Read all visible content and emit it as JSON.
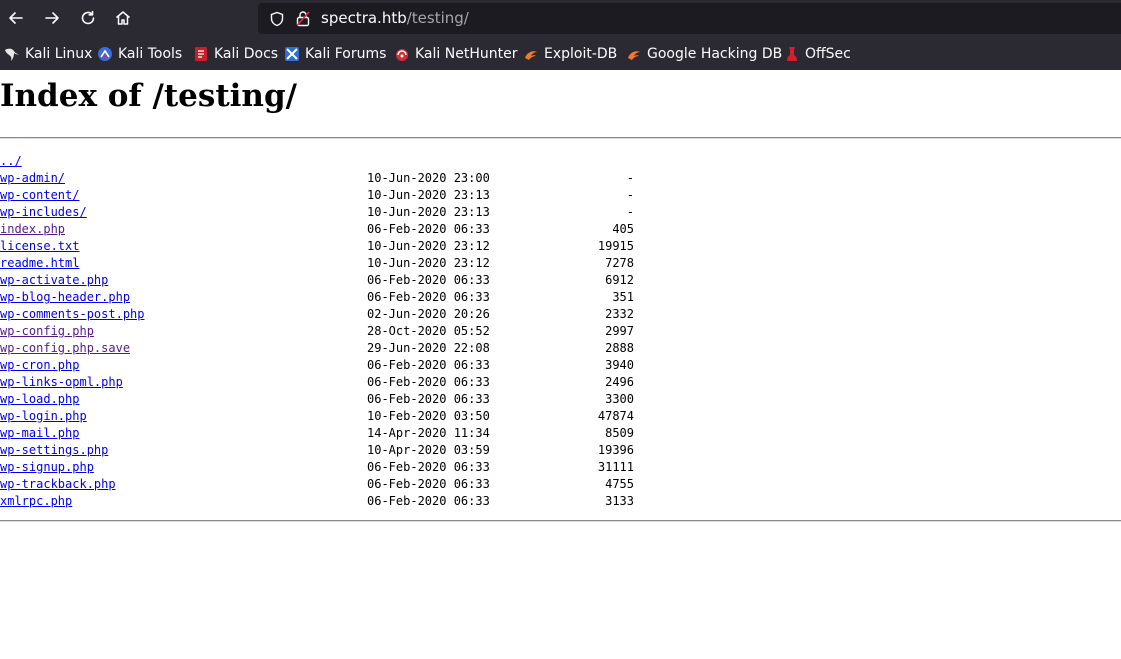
{
  "browser": {
    "url_host": "spectra.htb",
    "url_path": "/testing/",
    "bookmarks": [
      {
        "label": "Kali Linux",
        "icon": "kali-dragon-icon"
      },
      {
        "label": "Kali Tools",
        "icon": "kali-tools-icon"
      },
      {
        "label": "Kali Docs",
        "icon": "kali-docs-icon"
      },
      {
        "label": "Kali Forums",
        "icon": "kali-forums-icon"
      },
      {
        "label": "Kali NetHunter",
        "icon": "kali-nethunter-icon"
      },
      {
        "label": "Exploit-DB",
        "icon": "exploit-db-icon"
      },
      {
        "label": "Google Hacking DB",
        "icon": "ghdb-icon"
      },
      {
        "label": "OffSec",
        "icon": "offsec-icon"
      }
    ]
  },
  "page": {
    "title": "Index of /testing/",
    "parent_link": "../",
    "entries": [
      {
        "name": "wp-admin/",
        "date": "10-Jun-2020 23:00",
        "size": "-",
        "visited": false
      },
      {
        "name": "wp-content/",
        "date": "10-Jun-2020 23:13",
        "size": "-",
        "visited": false
      },
      {
        "name": "wp-includes/",
        "date": "10-Jun-2020 23:13",
        "size": "-",
        "visited": false
      },
      {
        "name": "index.php",
        "date": "06-Feb-2020 06:33",
        "size": "405",
        "visited": true
      },
      {
        "name": "license.txt",
        "date": "10-Jun-2020 23:12",
        "size": "19915",
        "visited": false
      },
      {
        "name": "readme.html",
        "date": "10-Jun-2020 23:12",
        "size": "7278",
        "visited": false
      },
      {
        "name": "wp-activate.php",
        "date": "06-Feb-2020 06:33",
        "size": "6912",
        "visited": false
      },
      {
        "name": "wp-blog-header.php",
        "date": "06-Feb-2020 06:33",
        "size": "351",
        "visited": false
      },
      {
        "name": "wp-comments-post.php",
        "date": "02-Jun-2020 20:26",
        "size": "2332",
        "visited": false
      },
      {
        "name": "wp-config.php",
        "date": "28-Oct-2020 05:52",
        "size": "2997",
        "visited": true
      },
      {
        "name": "wp-config.php.save",
        "date": "29-Jun-2020 22:08",
        "size": "2888",
        "visited": true
      },
      {
        "name": "wp-cron.php",
        "date": "06-Feb-2020 06:33",
        "size": "3940",
        "visited": false
      },
      {
        "name": "wp-links-opml.php",
        "date": "06-Feb-2020 06:33",
        "size": "2496",
        "visited": false
      },
      {
        "name": "wp-load.php",
        "date": "06-Feb-2020 06:33",
        "size": "3300",
        "visited": false
      },
      {
        "name": "wp-login.php",
        "date": "10-Feb-2020 03:50",
        "size": "47874",
        "visited": false
      },
      {
        "name": "wp-mail.php",
        "date": "14-Apr-2020 11:34",
        "size": "8509",
        "visited": false
      },
      {
        "name": "wp-settings.php",
        "date": "10-Apr-2020 03:59",
        "size": "19396",
        "visited": false
      },
      {
        "name": "wp-signup.php",
        "date": "06-Feb-2020 06:33",
        "size": "31111",
        "visited": false
      },
      {
        "name": "wp-trackback.php",
        "date": "06-Feb-2020 06:33",
        "size": "4755",
        "visited": false
      },
      {
        "name": "xmlrpc.php",
        "date": "06-Feb-2020 06:33",
        "size": "3133",
        "visited": false
      }
    ]
  }
}
